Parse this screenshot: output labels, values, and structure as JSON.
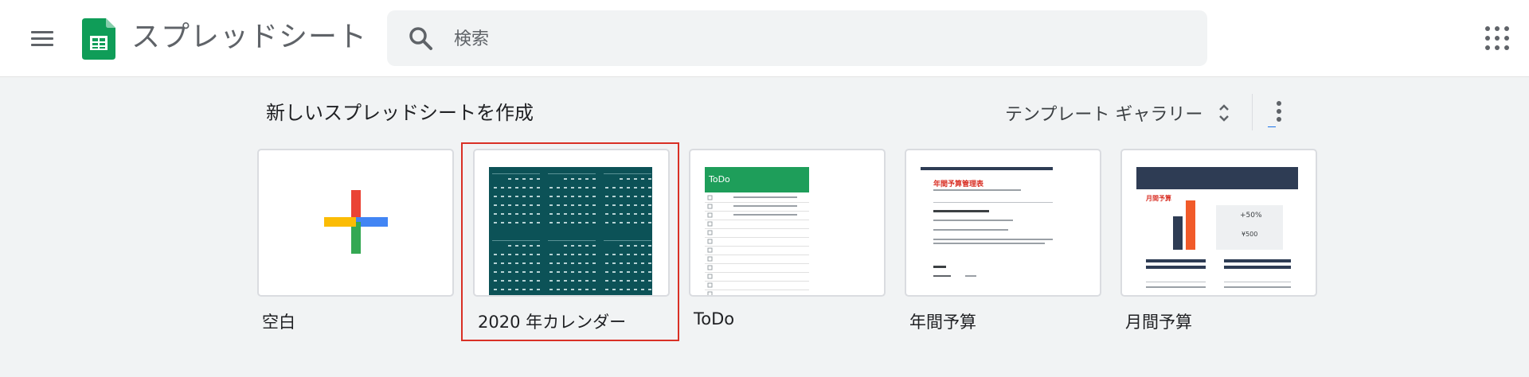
{
  "header": {
    "app_title": "スプレッドシート",
    "search_placeholder": "検索",
    "menu_icon": "hamburger-menu-icon",
    "logo_icon": "sheets-logo-icon",
    "apps_icon": "google-apps-grid-icon"
  },
  "section": {
    "title": "新しいスプレッドシートを作成",
    "gallery_label": "テンプレート ギャラリー"
  },
  "templates": [
    {
      "label": "空白"
    },
    {
      "label": "2020 年カレンダー"
    },
    {
      "label": "ToDo"
    },
    {
      "label": "年間予算"
    },
    {
      "label": "月間予算"
    }
  ],
  "thumbnails": {
    "todo_title": "ToDo",
    "annual_budget_title": "年間予算管理表",
    "monthly_budget_title": "月間予算",
    "monthly_percent": "+50%",
    "monthly_amount": "¥500"
  },
  "colors": {
    "accent_red": "#d93025",
    "sheets_green": "#0f9d58",
    "calendar_teal": "#0c5257",
    "budget_orange": "#f15a29",
    "budget_navy": "#2e3c54"
  }
}
